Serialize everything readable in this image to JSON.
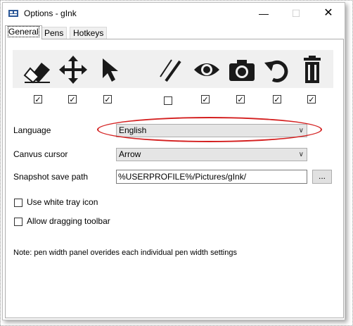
{
  "window": {
    "title": "Options - gInk",
    "minimize_glyph": "—",
    "maximize_glyph": "☐",
    "close_glyph": "✕"
  },
  "tabs": [
    {
      "label": "General",
      "active": true
    },
    {
      "label": "Pens",
      "active": false
    },
    {
      "label": "Hotkeys",
      "active": false
    }
  ],
  "toolbar": {
    "tools": [
      {
        "name": "eraser-icon",
        "checked": true
      },
      {
        "name": "move-icon",
        "checked": true
      },
      {
        "name": "pointer-icon",
        "checked": true
      },
      {
        "name": "pen-width-icon",
        "checked": false
      },
      {
        "name": "eye-icon",
        "checked": true
      },
      {
        "name": "camera-icon",
        "checked": true
      },
      {
        "name": "undo-icon",
        "checked": true
      },
      {
        "name": "trash-icon",
        "checked": true
      }
    ],
    "check_glyph": "✓"
  },
  "settings": {
    "language_label": "Language",
    "language_value": "English",
    "cursor_label": "Canvus cursor",
    "cursor_value": "Arrow",
    "snapshot_label": "Snapshot save path",
    "snapshot_value": "%USERPROFILE%/Pictures/gInk/",
    "browse_label": "...",
    "white_tray_label": "Use white tray icon",
    "white_tray_checked": false,
    "drag_toolbar_label": "Allow dragging toolbar",
    "drag_toolbar_checked": false
  },
  "note": "Note: pen width panel overides each individual pen width settings",
  "colors": {
    "highlight": "#d42020",
    "toolbar_bg": "#f0f0f0"
  }
}
